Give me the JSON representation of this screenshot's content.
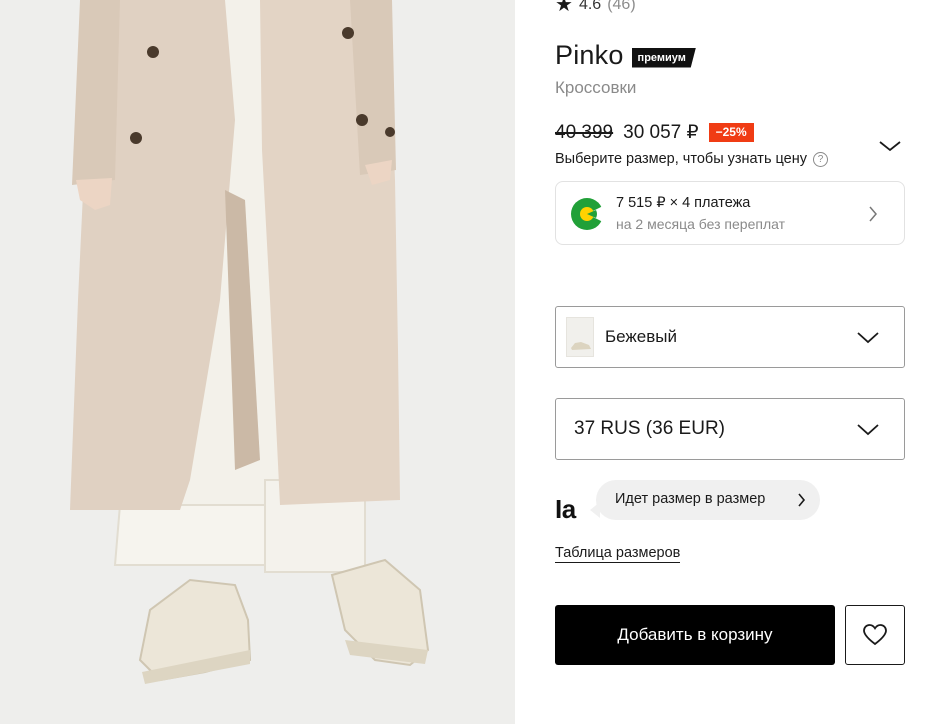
{
  "product": {
    "rating": {
      "star_icon": "star-icon",
      "value": "4.6",
      "count": "(46)"
    },
    "brand": "Pinko",
    "premium_badge": "премиум",
    "category": "Кроссовки",
    "price": {
      "old": "40 399",
      "new": "30 057 ₽",
      "discount": "−25%",
      "size_hint": "Выберите размер, чтобы узнать цену",
      "help_icon": "?"
    },
    "installment": {
      "line1": "7 515 ₽ × 4 платежа",
      "line2": "на 2 месяца без переплат"
    },
    "color_select": {
      "value": "Бежевый"
    },
    "size_select": {
      "value": "37 RUS (36 EUR)"
    },
    "fit": {
      "logo": "Ia",
      "text": "Идет размер в размер"
    },
    "size_table_link": "Таблица размеров",
    "cart_button": "Добавить в корзину"
  },
  "colors": {
    "discount": "#f03c14",
    "installment_green": "#21a038",
    "button_black": "#000000"
  }
}
